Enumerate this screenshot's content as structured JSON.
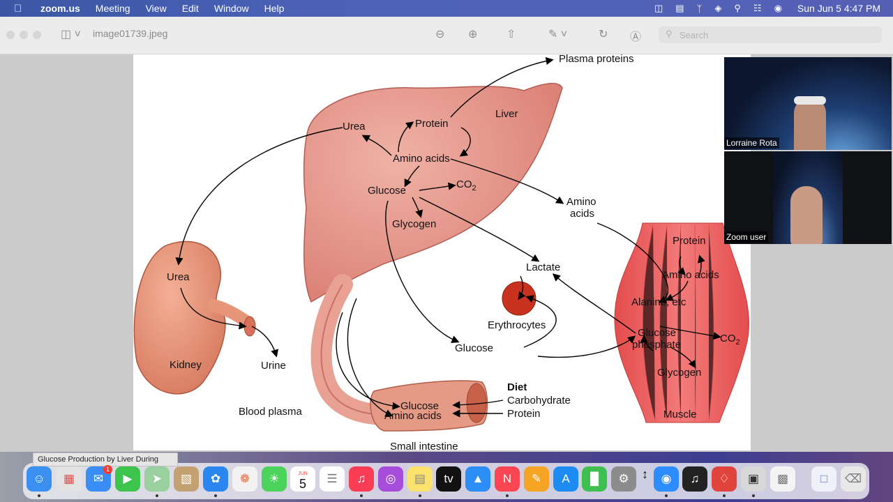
{
  "menubar": {
    "app": "zoom.us",
    "items": [
      "Meeting",
      "View",
      "Edit",
      "Window",
      "Help"
    ],
    "clock": "Sun Jun 5  4:47 PM"
  },
  "viewer": {
    "filename": "image01739.jpeg",
    "search_placeholder": "Search"
  },
  "figure": {
    "plasma_proteins": "Plasma proteins",
    "liver": "Liver",
    "urea_liver": "Urea",
    "protein_liver": "Protein",
    "amino_acids_liver": "Amino acids",
    "glucose_liver": "Glucose",
    "co2_liver": "CO",
    "co2_sub": "2",
    "glycogen_liver": "Glycogen",
    "amino_acids_blood_1": "Amino",
    "amino_acids_blood_2": "acids",
    "lactate": "Lactate",
    "erythrocytes": "Erythrocytes",
    "glucose_blood": "Glucose",
    "urea_kidney": "Urea",
    "kidney": "Kidney",
    "urine": "Urine",
    "blood_plasma": "Blood plasma",
    "small_intestine": "Small intestine",
    "glucose_intestine": "Glucose",
    "amino_acids_intestine": "Amino acids",
    "diet": "Diet",
    "carbohydrate": "Carbohydrate",
    "protein_diet": "Protein",
    "protein_muscle": "Protein",
    "amino_acids_muscle": "Amino acids",
    "alanine": "Alanine, etc",
    "glucose_phosphate_1": "Glucose",
    "glucose_phosphate_2": "phosphate",
    "co2_muscle": "CO",
    "glycogen_muscle": "Glycogen",
    "muscle": "Muscle"
  },
  "participants": [
    {
      "name": "Lorraine Rota"
    },
    {
      "name": "Zoom user"
    }
  ],
  "dock": {
    "tooltip": "Glucose Production by Liver During",
    "calendar_month": "JUN",
    "calendar_day": "5",
    "mail_badge": "1"
  },
  "colors": {
    "menubar": "#4a5fb3",
    "liver": "#e3988f",
    "muscle": "#ec6a6a",
    "erythrocyte": "#c8321e"
  }
}
